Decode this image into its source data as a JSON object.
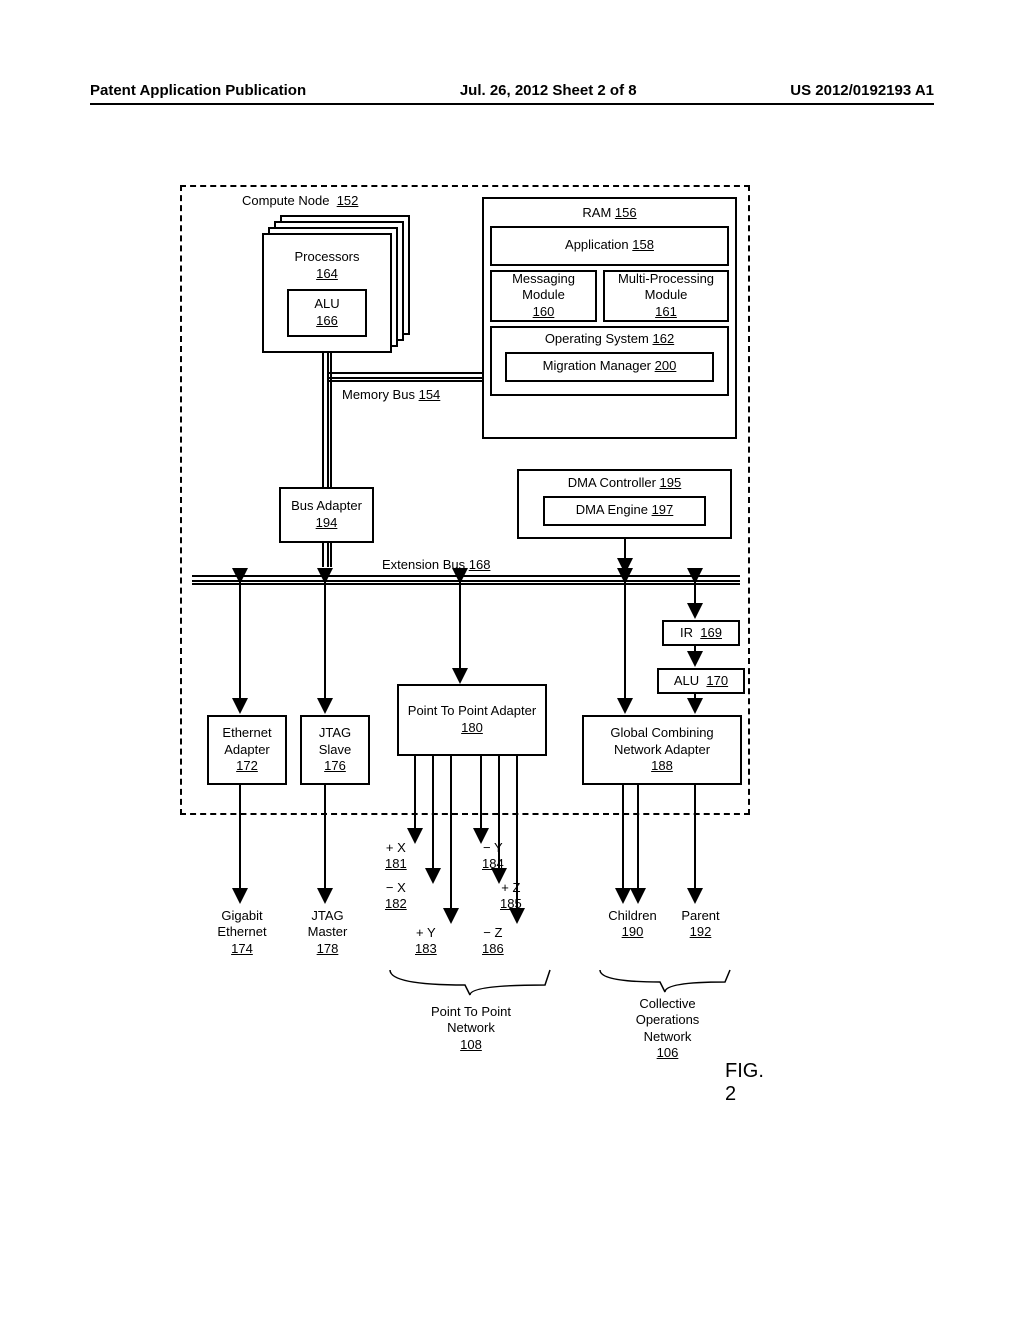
{
  "header": {
    "left": "Patent Application Publication",
    "center": "Jul. 26, 2012  Sheet 2 of 8",
    "right": "US 2012/0192193 A1"
  },
  "figure_label": "FIG. 2",
  "compute_node": {
    "label": "Compute Node",
    "ref": "152"
  },
  "processors": {
    "label": "Processors",
    "ref": "164"
  },
  "alu_inner": {
    "label": "ALU",
    "ref": "166"
  },
  "ram": {
    "label": "RAM",
    "ref": "156"
  },
  "application": {
    "label": "Application",
    "ref": "158"
  },
  "msg_module": {
    "label": "Messaging Module",
    "ref": "160"
  },
  "mp_module": {
    "label": "Multi-Processing Module",
    "ref": "161"
  },
  "os": {
    "label": "Operating System",
    "ref": "162"
  },
  "migration": {
    "label": "Migration Manager",
    "ref": "200"
  },
  "memory_bus": {
    "label": "Memory Bus",
    "ref": "154"
  },
  "dma_controller": {
    "label": "DMA Controller",
    "ref": "195"
  },
  "dma_engine": {
    "label": "DMA Engine",
    "ref": "197"
  },
  "bus_adapter": {
    "label": "Bus Adapter",
    "ref": "194"
  },
  "extension_bus": {
    "label": "Extension Bus",
    "ref": "168"
  },
  "ir": {
    "label": "IR",
    "ref": "169"
  },
  "alu2": {
    "label": "ALU",
    "ref": "170"
  },
  "p2p_adapter": {
    "label": "Point To Point Adapter",
    "ref": "180"
  },
  "eth_adapter": {
    "label": "Ethernet Adapter",
    "ref": "172"
  },
  "jtag_slave": {
    "label": "JTAG Slave",
    "ref": "176"
  },
  "gc_adapter": {
    "label": "Global Combining Network Adapter",
    "ref": "188"
  },
  "gigabit": {
    "label": "Gigabit Ethernet",
    "ref": "174"
  },
  "jtag_master": {
    "label": "JTAG Master",
    "ref": "178"
  },
  "children": {
    "label": "Children",
    "ref": "190"
  },
  "parent_lbl": {
    "label": "Parent",
    "ref": "192"
  },
  "p2p_network": {
    "label": "Point To Point Network",
    "ref": "108"
  },
  "collective_net": {
    "label": "Collective Operations Network",
    "ref": "106"
  },
  "dirs": {
    "px": {
      "label": "+ X",
      "ref": "181"
    },
    "nx": {
      "label": "− X",
      "ref": "182"
    },
    "py": {
      "label": "+ Y",
      "ref": "183"
    },
    "ny": {
      "label": "− Y",
      "ref": "184"
    },
    "pz": {
      "label": "+ Z",
      "ref": "185"
    },
    "nz": {
      "label": "− Z",
      "ref": "186"
    }
  }
}
